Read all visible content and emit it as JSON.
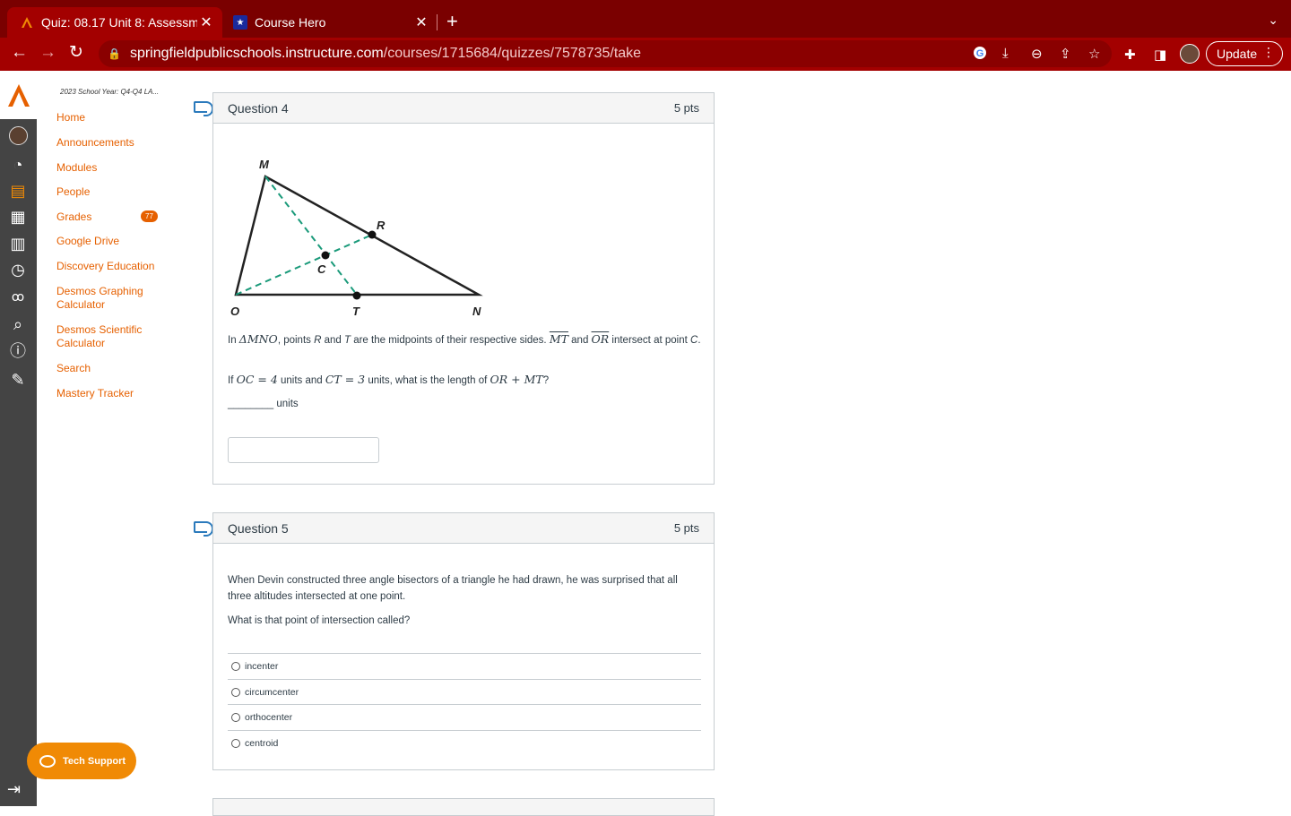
{
  "browser": {
    "tabs": [
      {
        "title": "Quiz: 08.17 Unit 8: Assessmen",
        "favicon": "canvas-icon",
        "active": true
      },
      {
        "title": "Course Hero",
        "favicon": "star-icon",
        "active": false
      }
    ],
    "url_domain": "springfieldpublicschools.instructure.com",
    "url_path": "/courses/1715684/quizzes/7578735/take",
    "update_label": "Update",
    "accent": "#a30000"
  },
  "course_nav": {
    "breadcrumb": "2023 School Year: Q4-Q4 LA...",
    "items": [
      {
        "label": "Home"
      },
      {
        "label": "Announcements"
      },
      {
        "label": "Modules"
      },
      {
        "label": "People"
      },
      {
        "label": "Grades",
        "badge": "77"
      },
      {
        "label": "Google Drive"
      },
      {
        "label": "Discovery Education"
      },
      {
        "label": "Desmos Graphing Calculator"
      },
      {
        "label": "Desmos Scientific Calculator"
      },
      {
        "label": "Search"
      },
      {
        "label": "Mastery Tracker"
      }
    ],
    "tech_support": "Tech Support",
    "link_color": "#e66000"
  },
  "question4": {
    "title": "Question 4",
    "points": "5 pts",
    "figure_labels": {
      "M": "M",
      "R": "R",
      "C": "C",
      "O": "O",
      "T": "T",
      "N": "N"
    },
    "text_intro": "In ",
    "tri": "ΔMNO",
    "text_mid1": ", points ",
    "r": "R",
    "text_and": " and ",
    "t": "T",
    "text_mid2": " are the midpoints of their respective sides. ",
    "seg1": "MT",
    "text_and2": " and ",
    "seg2": "OR",
    "text_end": " intersect at point ",
    "c": "C",
    "period": ".",
    "if_text": "If ",
    "oc": "OC = 4",
    "units_and": " units and ",
    "ct": "CT = 3",
    "what": " units, what is the length of ",
    "sum": "OR + MT",
    "qmark": "?",
    "blank": "________",
    "units": " units",
    "answer_value": ""
  },
  "question5": {
    "title": "Question 5",
    "points": "5 pts",
    "text1": "When Devin constructed three angle bisectors of a triangle he had drawn, he was surprised that all three altitudes intersected at one point.",
    "text2": "What is that point of intersection called?",
    "options": [
      "incenter",
      "circumcenter",
      "orthocenter",
      "centroid"
    ]
  }
}
